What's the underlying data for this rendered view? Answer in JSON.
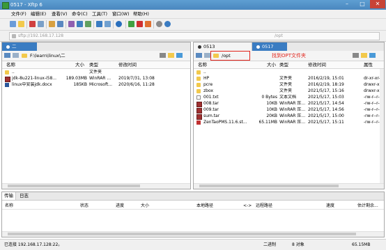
{
  "window": {
    "title": "0517 - Xftp 6",
    "min_icon": "minimize-icon",
    "max_icon": "maximize-icon",
    "close_icon": "close-icon"
  },
  "menu": [
    "文件(F)",
    "编辑(E)",
    "查看(V)",
    "命令(C)",
    "工具(T)",
    "窗口(W)",
    "帮助(H)"
  ],
  "address": {
    "host": "sftp://192.168.17.128",
    "remote_path": "/opt"
  },
  "left_pane": {
    "tab_label": "二",
    "path": "F:\\learn\\linux\\二",
    "columns": {
      "name": "名称",
      "size": "大小",
      "type": "类型",
      "modified": "修改时间"
    },
    "files": [
      {
        "name": "..",
        "size": "",
        "type": "文件夹",
        "modified": "",
        "icon": "up-folder-icon"
      },
      {
        "name": "jdk-8u221-linux-i58...",
        "size": "189.03MB",
        "type": "WinRAR ...",
        "modified": "2019/7/31, 13:08",
        "icon": "archive-icon"
      },
      {
        "name": "linux中安装jdk.docx",
        "size": "185KB",
        "type": "Microsoft...",
        "modified": "2020/6/16, 11:28",
        "icon": "word-doc-icon"
      }
    ]
  },
  "right_pane": {
    "tabs": [
      {
        "label": "0513 (Disconnected)",
        "state": "inactive"
      },
      {
        "label": "0517",
        "state": "active"
      }
    ],
    "path": "/opt",
    "annotation": "找到OPT文件夹",
    "columns": {
      "name": "名称",
      "size": "大小",
      "type": "类型",
      "modified": "修改时间",
      "attr": "属性"
    },
    "files": [
      {
        "name": "..",
        "size": "",
        "type": "",
        "modified": "",
        "attr": "",
        "icon": "up-folder-icon"
      },
      {
        "name": "HP",
        "size": "",
        "type": "文件夹",
        "modified": "2016/2/19, 15:01",
        "attr": "dr-xr-xr-x",
        "icon": "folder-icon"
      },
      {
        "name": "pcre",
        "size": "",
        "type": "文件夹",
        "modified": "2016/2/19, 18:19",
        "attr": "drwxr-xr-x",
        "icon": "folder-icon"
      },
      {
        "name": "zbox",
        "size": "",
        "type": "文件夹",
        "modified": "2021/5/17, 15:16",
        "attr": "drwxr-xr-x",
        "icon": "folder-icon"
      },
      {
        "name": "001.txt",
        "size": "0 Bytes",
        "type": "文本文档",
        "modified": "2021/5/17, 15:03",
        "attr": "-rw-r--r--",
        "icon": "text-file-icon"
      },
      {
        "name": "008.tar",
        "size": "10KB",
        "type": "WinRAR 压...",
        "modified": "2021/5/17, 14:54",
        "attr": "-rw-r--r--",
        "icon": "archive-icon"
      },
      {
        "name": "009.tar",
        "size": "10KB",
        "type": "WinRAR 压...",
        "modified": "2021/5/17, 14:56",
        "attr": "-rw-r--r--",
        "icon": "archive-icon"
      },
      {
        "name": "sum.tar",
        "size": "20KB",
        "type": "WinRAR 压...",
        "modified": "2021/5/17, 15:00",
        "attr": "-rw-r--r--",
        "icon": "archive-icon"
      },
      {
        "name": "ZenTaoPMS.11.6.st...",
        "size": "65.11MB",
        "type": "WinRAR 压...",
        "modified": "2021/5/17, 15:11",
        "attr": "-rw-r--r--",
        "icon": "zentao-package-icon"
      }
    ]
  },
  "transfer": {
    "tabs": [
      "传输",
      "日志"
    ],
    "columns": [
      "名称",
      "状态",
      "进度",
      "大小",
      "本地路径",
      "<->",
      "远程路径",
      "速度",
      "估计剩余..."
    ]
  },
  "status": {
    "left": "已连接 192.168.17.128:22。",
    "mode": "二进制",
    "objects": "8 对象",
    "size": "65.15MB"
  },
  "colors": {
    "title_bar": "#4a87bf",
    "active_tab": "#3a7cc2",
    "annotation": "#e2231a",
    "folder": "#f2c94c"
  }
}
